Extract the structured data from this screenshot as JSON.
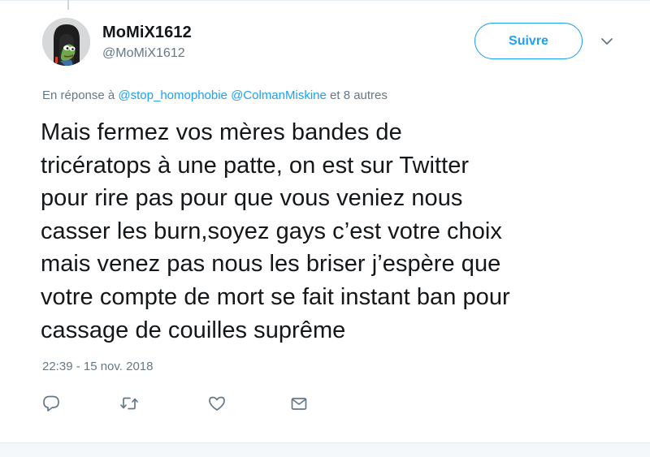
{
  "tweet": {
    "display_name": "MoMiX1612",
    "handle": "@MoMiX1612",
    "follow_label": "Suivre",
    "reply_context": {
      "prefix": "En réponse à ",
      "mention_1": "@stop_homophobie",
      "separator": " ",
      "mention_2": "@ColmanMiskine",
      "suffix": " et 8 autres"
    },
    "text_lines": [
      "Mais fermez vos mères bandes de",
      "tricératops à une patte, on est sur Twitter",
      "pour rire pas pour que vous veniez nous",
      "casser les burn,soyez gays c’est votre choix",
      "mais venez pas nous les briser j’espère que",
      "votre compte de mort se fait instant ban pour",
      "cassage de couilles suprême"
    ],
    "timestamp": "22:39 - 15 nov. 2018"
  },
  "icons": {
    "avatar": "pepe-frog-avatar",
    "more": "chevron-down-icon",
    "reply": "reply-icon",
    "retweet": "retweet-icon",
    "like": "heart-icon",
    "dm": "envelope-icon"
  },
  "colors": {
    "accent": "#1da1f2",
    "text": "#14171a",
    "secondary": "#657786",
    "icon": "#657786"
  }
}
